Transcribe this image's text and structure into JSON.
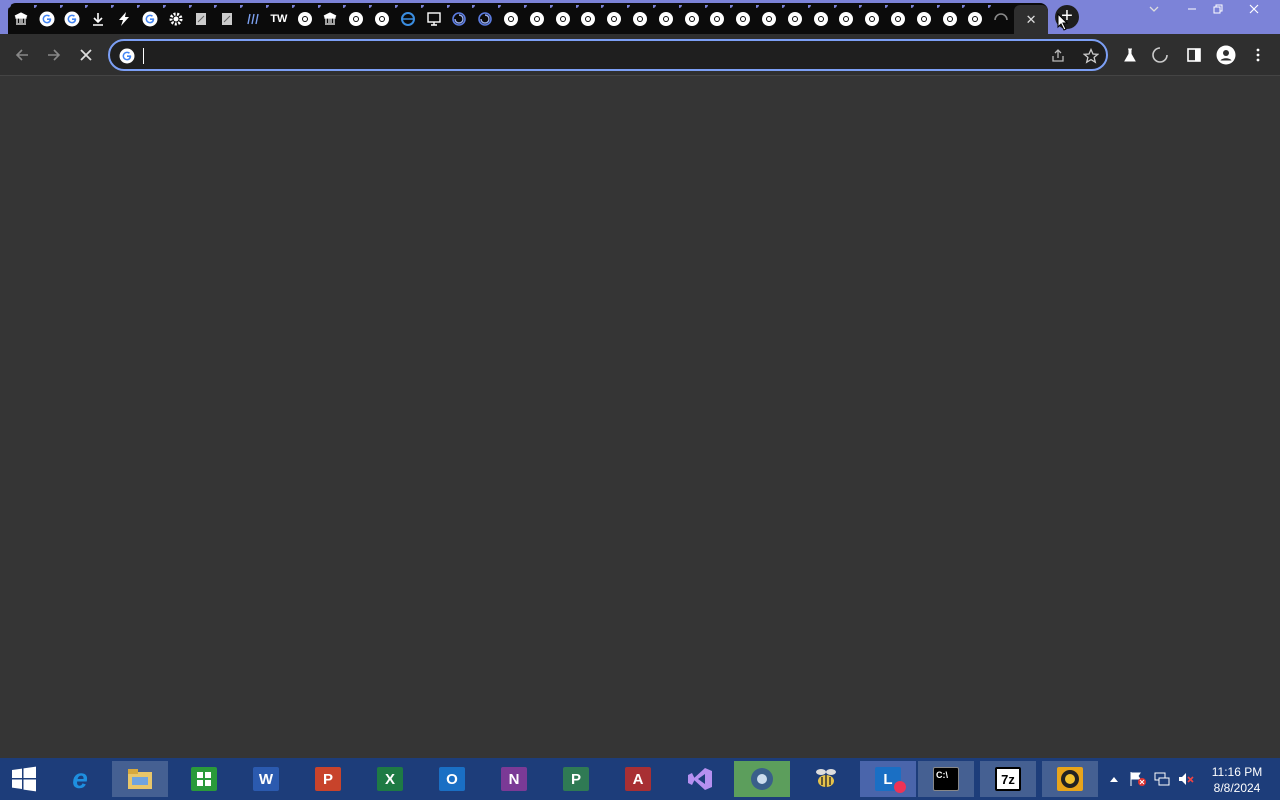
{
  "browser": {
    "tabs": [
      {
        "icon": "museum-icon"
      },
      {
        "icon": "google-icon"
      },
      {
        "icon": "google-icon"
      },
      {
        "icon": "download-icon"
      },
      {
        "icon": "lightning-icon"
      },
      {
        "icon": "google-icon"
      },
      {
        "icon": "gear-icon"
      },
      {
        "icon": "page-icon"
      },
      {
        "icon": "page-icon"
      },
      {
        "icon": "hash-icon"
      },
      {
        "icon": "tw-icon",
        "text": "TW"
      },
      {
        "icon": "chrome-icon"
      },
      {
        "icon": "museum-icon"
      },
      {
        "icon": "chrome-icon"
      },
      {
        "icon": "chrome-icon"
      },
      {
        "icon": "ie-icon"
      },
      {
        "icon": "monitor-icon"
      },
      {
        "icon": "swirl-icon"
      },
      {
        "icon": "swirl-icon"
      },
      {
        "icon": "chrome-icon"
      },
      {
        "icon": "chrome-icon"
      },
      {
        "icon": "chrome-icon"
      },
      {
        "icon": "chrome-icon"
      },
      {
        "icon": "chrome-icon"
      },
      {
        "icon": "chrome-icon"
      },
      {
        "icon": "chrome-icon"
      },
      {
        "icon": "chrome-icon"
      },
      {
        "icon": "chrome-icon"
      },
      {
        "icon": "chrome-icon"
      },
      {
        "icon": "chrome-icon"
      },
      {
        "icon": "chrome-icon"
      },
      {
        "icon": "chrome-icon"
      },
      {
        "icon": "chrome-icon"
      },
      {
        "icon": "chrome-icon"
      },
      {
        "icon": "chrome-icon"
      },
      {
        "icon": "chrome-icon"
      },
      {
        "icon": "chrome-icon"
      },
      {
        "icon": "chrome-icon"
      },
      {
        "icon": "loading-spinner-icon"
      }
    ],
    "active_tab_close": "✕",
    "new_tab": "+",
    "omnibox": {
      "value": "",
      "placeholder": ""
    },
    "accent": "#7c83d8"
  },
  "taskbar": {
    "apps": [
      {
        "name": "internet-explorer",
        "label": "e",
        "color": "#1e8fe0"
      },
      {
        "name": "file-explorer",
        "label": "",
        "color": "#e8c66a"
      },
      {
        "name": "store",
        "label": "",
        "color": "#2a9a3a"
      },
      {
        "name": "word",
        "label": "W",
        "color": "#2b5aaf"
      },
      {
        "name": "powerpoint",
        "label": "P",
        "color": "#c8432b"
      },
      {
        "name": "excel",
        "label": "X",
        "color": "#1e7a44"
      },
      {
        "name": "outlook",
        "label": "O",
        "color": "#1a6fc4"
      },
      {
        "name": "onenote",
        "label": "N",
        "color": "#7b3a96"
      },
      {
        "name": "project",
        "label": "P",
        "color": "#2f7a54"
      },
      {
        "name": "access",
        "label": "A",
        "color": "#a82f33"
      },
      {
        "name": "visual-studio",
        "label": "",
        "color": "#7d4ec4"
      },
      {
        "name": "chrome",
        "label": "",
        "color": "#6cbe6c"
      },
      {
        "name": "bee-app",
        "label": "",
        "color": "#e6c34a"
      },
      {
        "name": "lync",
        "label": "L",
        "color": "#1a6fc4"
      },
      {
        "name": "command-prompt",
        "label": "C:\\",
        "color": "#000000"
      },
      {
        "name": "7zip",
        "label": "7z",
        "color": "#000000"
      },
      {
        "name": "badge-app",
        "label": "",
        "color": "#e8a41a"
      }
    ],
    "clock": {
      "time": "11:16 PM",
      "date": "8/8/2024"
    }
  }
}
